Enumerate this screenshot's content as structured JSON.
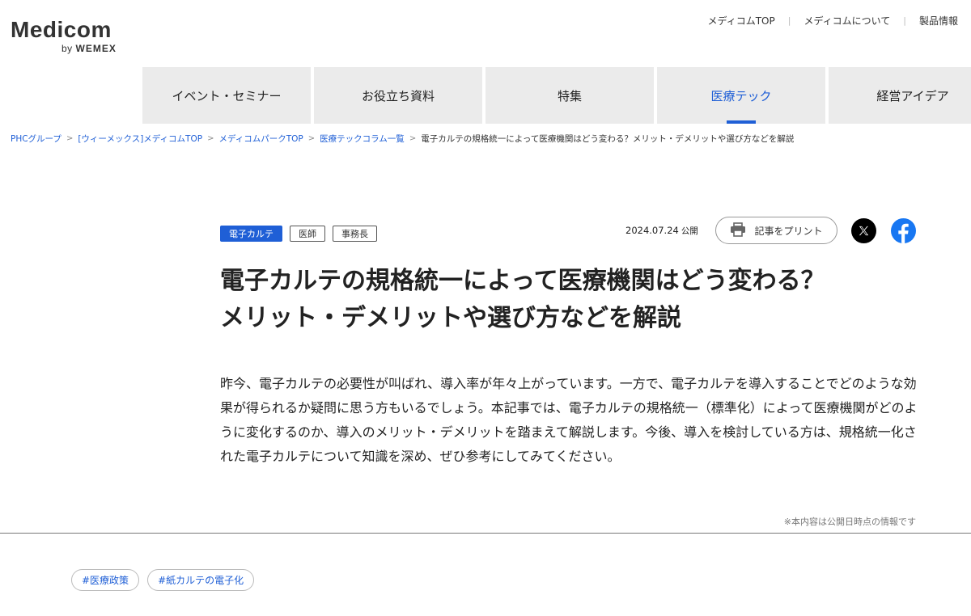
{
  "header": {
    "logo_main": "Medicom",
    "logo_by": "by",
    "logo_brand": "WEMEX",
    "top_links": [
      "メディコムTOP",
      "メディコムについて",
      "製品情報"
    ]
  },
  "nav": {
    "items": [
      "イベント・セミナー",
      "お役立ち資料",
      "特集",
      "医療テック",
      "経営アイデア"
    ],
    "active": "医療テック"
  },
  "breadcrumb": {
    "links": [
      "PHCグループ",
      "[ウィーメックス]メディコムTOP",
      "メディコムパークTOP",
      "医療テックコラム一覧"
    ],
    "current": "電子カルテの規格統一によって医療機関はどう変わる？メリット・デメリットや選び方などを解説"
  },
  "article": {
    "tags": [
      "電子カルテ",
      "医師",
      "事務長"
    ],
    "date": "2024.07.24",
    "date_label": "公開",
    "print_label": "記事をプリント",
    "title_line1": "電子カルテの規格統一によって医療機関はどう変わる？",
    "title_line2": "メリット・デメリットや選び方などを解説",
    "lead": "昨今、電子カルテの必要性が叫ばれ、導入率が年々上がっています。一方で、電子カルテを導入することでどのような効果が得られるか疑問に思う方もいるでしょう。本記事では、電子カルテの規格統一（標準化）によって医療機関がどのように変化するのか、導入のメリット・デメリットを踏まえて解説します。今後、導入を検討している方は、規格統一化された電子カルテについて知識を深め、ぜひ参考にしてみてください。",
    "note": "※本内容は公開日時点の情報です"
  },
  "hashtags": [
    "#医療政策",
    "#紙カルテの電子化"
  ],
  "icons": {
    "print": "printer-icon",
    "x": "x-logo-icon",
    "facebook": "facebook-icon"
  },
  "colors": {
    "accent": "#1f5fd6",
    "facebook": "#1877f2",
    "nav_bg": "#ebebeb"
  }
}
